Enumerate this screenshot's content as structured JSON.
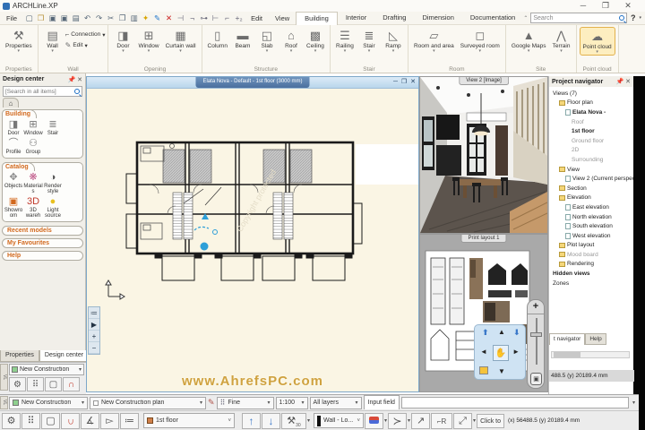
{
  "window": {
    "title": "ARCHLine.XP",
    "controls": [
      "minimize",
      "maximize",
      "close"
    ]
  },
  "menubar": {
    "file": "File",
    "menus": [
      "Edit",
      "View"
    ],
    "tabs": [
      "Building",
      "Interior",
      "Drafting",
      "Dimension",
      "Documentation"
    ],
    "active_tab": "Building",
    "search_placeholder": "Search",
    "help_label": "?",
    "quick_icons": [
      "new-document",
      "open",
      "save",
      "save-as",
      "print",
      "undo",
      "redo",
      "cut",
      "copy",
      "paste",
      "format-painter",
      "pen",
      "delete",
      "snap-endpoint",
      "snap-perpendicular",
      "snap-midpoint",
      "snap-intersection",
      "snap-angle",
      "snap-relative"
    ]
  },
  "ribbon": {
    "groups": [
      {
        "name": "Properties",
        "buttons": [
          {
            "label": "Properties",
            "icon": "properties",
            "caret": true
          }
        ]
      },
      {
        "name": "Wall",
        "buttons": [
          {
            "label": "Wall",
            "icon": "wall",
            "caret": true
          }
        ],
        "small_buttons": [
          {
            "label": "Connection",
            "icon": "connection",
            "caret": true
          },
          {
            "label": "Edit",
            "icon": "edit",
            "caret": true
          }
        ]
      },
      {
        "name": "Opening",
        "buttons": [
          {
            "label": "Door",
            "icon": "door",
            "caret": true
          },
          {
            "label": "Window",
            "icon": "window",
            "caret": true
          },
          {
            "label": "Curtain wall",
            "icon": "curtain-wall",
            "caret": true
          }
        ]
      },
      {
        "name": "Structure",
        "buttons": [
          {
            "label": "Column",
            "icon": "column"
          },
          {
            "label": "Beam",
            "icon": "beam"
          },
          {
            "label": "Slab",
            "icon": "slab",
            "caret": true
          },
          {
            "label": "Roof",
            "icon": "roof",
            "caret": true
          },
          {
            "label": "Ceiling",
            "icon": "ceiling",
            "caret": true
          }
        ]
      },
      {
        "name": "Stair",
        "buttons": [
          {
            "label": "Railing",
            "icon": "railing",
            "caret": true
          },
          {
            "label": "Stair",
            "icon": "stair",
            "caret": true
          },
          {
            "label": "Ramp",
            "icon": "ramp",
            "caret": true
          }
        ]
      },
      {
        "name": "Room",
        "buttons": [
          {
            "label": "Room and area",
            "icon": "room-and-area",
            "caret": true
          },
          {
            "label": "Surveyed room",
            "icon": "surveyed-room",
            "caret": true
          }
        ]
      },
      {
        "name": "Site",
        "buttons": [
          {
            "label": "Google Maps",
            "icon": "google-maps",
            "caret": true
          },
          {
            "label": "Terrain",
            "icon": "terrain",
            "caret": true
          }
        ]
      },
      {
        "name": "Point cloud",
        "buttons": [
          {
            "label": "Point cloud",
            "icon": "point-cloud",
            "caret": true,
            "highlight": true
          }
        ]
      }
    ]
  },
  "design_center": {
    "title": "Design center",
    "search_placeholder": "[Search in all items]",
    "sections": [
      {
        "title": "Building",
        "items": [
          {
            "label": "Door",
            "icon": "door"
          },
          {
            "label": "Window",
            "icon": "window"
          },
          {
            "label": "Stair",
            "icon": "stair"
          },
          {
            "label": "Profile",
            "icon": "profile"
          },
          {
            "label": "Group",
            "icon": "group"
          }
        ]
      },
      {
        "title": "Catalog",
        "items": [
          {
            "label": "Objects",
            "icon": "objects"
          },
          {
            "label": "Materials",
            "icon": "materials"
          },
          {
            "label": "Render style",
            "icon": "render-style"
          },
          {
            "label": "Showroom",
            "icon": "showroom"
          },
          {
            "label": "3D wareh",
            "icon": "3d-warehouse"
          },
          {
            "label": "Light source",
            "icon": "light-source"
          }
        ]
      }
    ],
    "bars": [
      "Recent models",
      "My Favourites",
      "Help"
    ],
    "tabs": [
      "Properties",
      "Design center"
    ],
    "active_tab": "Design center"
  },
  "plan_window": {
    "title": "Elata Nova - Default - 1st floor (3000 mm)",
    "watermark": "www.AhrefsPC.com",
    "copyright_diag": "Copyright protected",
    "mini_toolbar": [
      "list",
      "play",
      "zoom-in",
      "zoom-out"
    ]
  },
  "view2_window": {
    "title": "View 2 [Image]"
  },
  "print_window": {
    "title": "Print layout 1"
  },
  "project_navigator": {
    "title": "Project navigator",
    "items": [
      {
        "label": "Views (7)",
        "depth": 0,
        "icon": "none",
        "style": "plain"
      },
      {
        "label": "Floor plan",
        "depth": 1,
        "icon": "folder",
        "style": "plain"
      },
      {
        "label": "Elata Nova -",
        "depth": 2,
        "icon": "page",
        "style": "bold"
      },
      {
        "label": "Roof",
        "depth": 3,
        "icon": "none",
        "style": "gray"
      },
      {
        "label": "1st floor",
        "depth": 3,
        "icon": "none",
        "style": "bold"
      },
      {
        "label": "Ground floor",
        "depth": 3,
        "icon": "none",
        "style": "gray"
      },
      {
        "label": "2D",
        "depth": 3,
        "icon": "none",
        "style": "gray"
      },
      {
        "label": "Surrounding",
        "depth": 3,
        "icon": "none",
        "style": "gray"
      },
      {
        "label": "View",
        "depth": 1,
        "icon": "folder",
        "style": "plain"
      },
      {
        "label": "View 2 (Current perspecti",
        "depth": 2,
        "icon": "page",
        "style": "plain"
      },
      {
        "label": "Section",
        "depth": 1,
        "icon": "folder",
        "style": "plain"
      },
      {
        "label": "Elevation",
        "depth": 1,
        "icon": "folder",
        "style": "plain"
      },
      {
        "label": "East elevation",
        "depth": 2,
        "icon": "page",
        "style": "plain"
      },
      {
        "label": "North elevation",
        "depth": 2,
        "icon": "page",
        "style": "plain"
      },
      {
        "label": "South elevation",
        "depth": 2,
        "icon": "page",
        "style": "plain"
      },
      {
        "label": "West elevation",
        "depth": 2,
        "icon": "page",
        "style": "plain"
      },
      {
        "label": "Plot layout",
        "depth": 1,
        "icon": "folder",
        "style": "plain"
      },
      {
        "label": "Mood board",
        "depth": 1,
        "icon": "folder",
        "style": "gray"
      },
      {
        "label": "Rendering",
        "depth": 1,
        "icon": "folder",
        "style": "plain"
      },
      {
        "label": "Hidden views",
        "depth": 0,
        "icon": "none",
        "style": "bold"
      },
      {
        "label": "Zones",
        "depth": 0,
        "icon": "none",
        "style": "plain"
      }
    ],
    "tabs": [
      "t navigator",
      "Help"
    ],
    "active_tab": "t navigator",
    "coords_partial": "488.5   (y) 20189.4 mm"
  },
  "status_bar_1": {
    "layer_set": "New Construction",
    "plan_name": "New Construction plan",
    "snap_mode": "Fine",
    "scale": "1:100",
    "layer_filter": "All layers",
    "input_label": "Input field",
    "input_value": ""
  },
  "status_bar_2": {
    "icons": [
      "settings-gear",
      "grid-snap",
      "selection-marquee",
      "magnet-snap",
      "angle-constraint",
      "select-cursor",
      "list-properties"
    ],
    "floor": "1st floor",
    "hammer_value": "30",
    "wall_style": "Wall - Lo...",
    "click_hint": "Click to",
    "coords": "(x) 56488.5   (y) 20189.4 mm"
  },
  "bottom_left_dock": {
    "layer_set": "New Construction",
    "icons": [
      "settings-gear",
      "grid-snap",
      "selection-marquee",
      "magnet-snap"
    ]
  }
}
